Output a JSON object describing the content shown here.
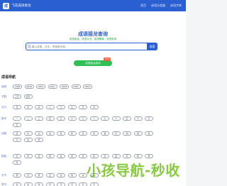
{
  "header": {
    "logo_char": "成",
    "site_name": "飞花成语接龙",
    "nav": [
      "首页",
      "成语分类器",
      "成语字典"
    ]
  },
  "hero": {
    "title": "成语接龙查询",
    "subtitle": "成语接龙、成语大全、成语解释、成语查询",
    "search_placeholder": "输入成语、汉字、拼音首字母...",
    "search_button": "成语",
    "green_button": "成语接龙游戏",
    "badge": "HOT"
  },
  "nav_card": {
    "title": "成语导航",
    "rows": [
      {
        "label": "结构",
        "tags": [
          "AABB",
          "ABAB",
          "ABCA",
          "ABCC",
          "ABCB",
          "AABC",
          "ABCD"
        ]
      },
      {
        "label": "字数",
        "tags": [
          "三字",
          "四字"
        ]
      },
      {
        "label": "五行",
        "tags": [
          "金",
          "木",
          "水",
          "火",
          "土",
          "山",
          "石",
          "风"
        ]
      },
      {
        "label": "数字",
        "tags": [
          "一",
          "二",
          "三",
          "四",
          "五",
          "六",
          "七",
          "八",
          "九",
          "十",
          "百",
          "千",
          "万",
          "亿"
        ]
      },
      {
        "label": "动物",
        "tags": [
          "鼠",
          "牛",
          "虎",
          "兔",
          "龙",
          "蛇",
          "马",
          "羊",
          "猴",
          "鸡",
          "狗",
          "猪",
          "鱼",
          "鸟",
          "虫",
          "鹤"
        ]
      },
      {
        "label": "颜色",
        "tags": [
          "红",
          "黄",
          "蓝",
          "绿",
          "白",
          "黑",
          "青",
          "紫",
          "金",
          "银",
          "灰",
          "粉",
          "橙",
          "赤"
        ]
      },
      {
        "label": "天气",
        "tags": [
          "雨",
          "雪",
          "风",
          "云",
          "雷",
          "电",
          "冰",
          "霜"
        ]
      },
      {
        "label": "季节",
        "tags": [
          "春",
          "夏",
          "秋",
          "冬",
          "日",
          "月",
          "星",
          "天"
        ]
      }
    ]
  },
  "watermark": "小孩导航-秒收"
}
